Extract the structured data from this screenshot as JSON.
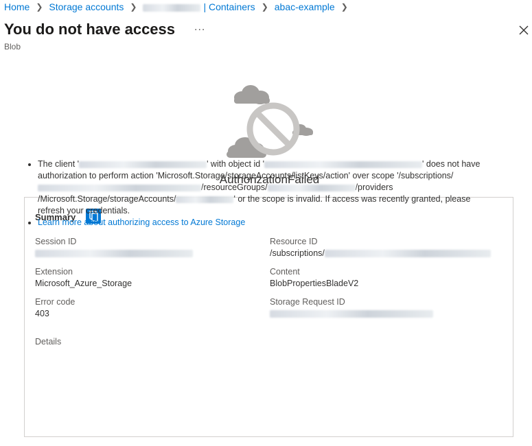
{
  "breadcrumb": {
    "home": "Home",
    "storage_accounts": "Storage accounts",
    "containers_suffix": "| Containers",
    "container": "abac-example"
  },
  "header": {
    "title": "You do not have access",
    "more": "...",
    "subtitle": "Blob"
  },
  "error": {
    "title": "AuthorizationFailed"
  },
  "summary": {
    "label": "Summary",
    "session_id_label": "Session ID",
    "resource_id_label": "Resource ID",
    "resource_id_prefix": "/subscriptions/",
    "extension_label": "Extension",
    "extension_value": "Microsoft_Azure_Storage",
    "content_label": "Content",
    "content_value": "BlobPropertiesBladeV2",
    "error_code_label": "Error code",
    "error_code_value": "403",
    "storage_request_id_label": "Storage Request ID"
  },
  "details": {
    "label": "Details",
    "p1": "The client '",
    "p2": "' with object id '",
    "p3": "' does not have authorization to perform action 'Microsoft.Storage/storageAccounts/listKeys/action' over scope '/subscriptions/",
    "p4": "/resourceGroups/",
    "p5": "/providers /Microsoft.Storage/storageAccounts/",
    "p6": "' or the scope is invalid. If access was recently granted, please refresh your credentials.",
    "link": "Learn more about authorizing access to Azure Storage"
  },
  "colors": {
    "accent": "#0078d4",
    "text": "#323130",
    "muted": "#605e5c",
    "border": "#d2d0ce"
  }
}
